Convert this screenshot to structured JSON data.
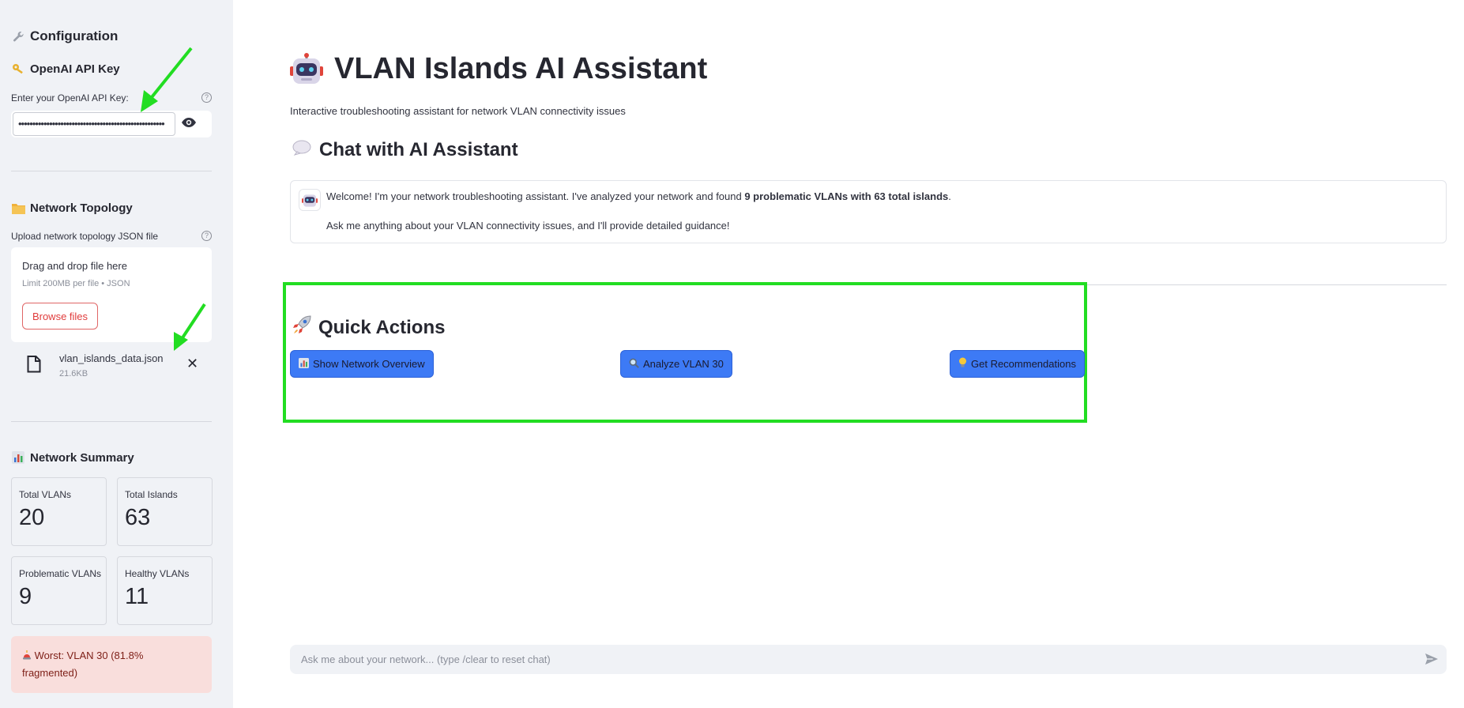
{
  "sidebar": {
    "config_title": "Configuration",
    "api_section_title": "OpenAI API Key",
    "api_key_label": "Enter your OpenAI API Key:",
    "api_key_value": "••••••••••••••••••••••••••••••••••••••••••••••••••••",
    "topology_title": "Network Topology",
    "upload_label": "Upload network topology JSON file",
    "drop_title": "Drag and drop file here",
    "drop_limit": "Limit 200MB per file • JSON",
    "browse_label": "Browse files",
    "file_name": "vlan_islands_data.json",
    "file_size": "21.6KB",
    "summary_title": "Network Summary",
    "metrics": [
      {
        "label": "Total VLANs",
        "value": "20"
      },
      {
        "label": "Total Islands",
        "value": "63"
      },
      {
        "label": "Problematic VLANs",
        "value": "9"
      },
      {
        "label": "Healthy VLANs",
        "value": "11"
      }
    ],
    "worst_text": "Worst: VLAN 30 (81.8% fragmented)"
  },
  "main": {
    "title": "VLAN Islands AI Assistant",
    "subtitle": "Interactive troubleshooting assistant for network VLAN connectivity issues",
    "chat_title": "Chat with AI Assistant",
    "welcome_pre": "Welcome! I'm your network troubleshooting assistant. I've analyzed your network and found ",
    "welcome_bold": "9 problematic VLANs with 63 total islands",
    "welcome_post": ".",
    "welcome_line2": "Ask me anything about your VLAN connectivity issues, and I'll provide detailed guidance!",
    "quick_title": "Quick Actions",
    "buttons": {
      "overview": "Show Network Overview",
      "analyze": "Analyze VLAN 30",
      "recommend": "Get Recommendations"
    },
    "chat_placeholder": "Ask me about your network... (type /clear to reset chat)"
  },
  "colors": {
    "sidebar_bg": "#f0f2f6",
    "button_blue": "#3d7af5",
    "annotation_green": "#22dd22",
    "worst_bg": "#f9dedc",
    "browse_red": "#e03c3c"
  }
}
